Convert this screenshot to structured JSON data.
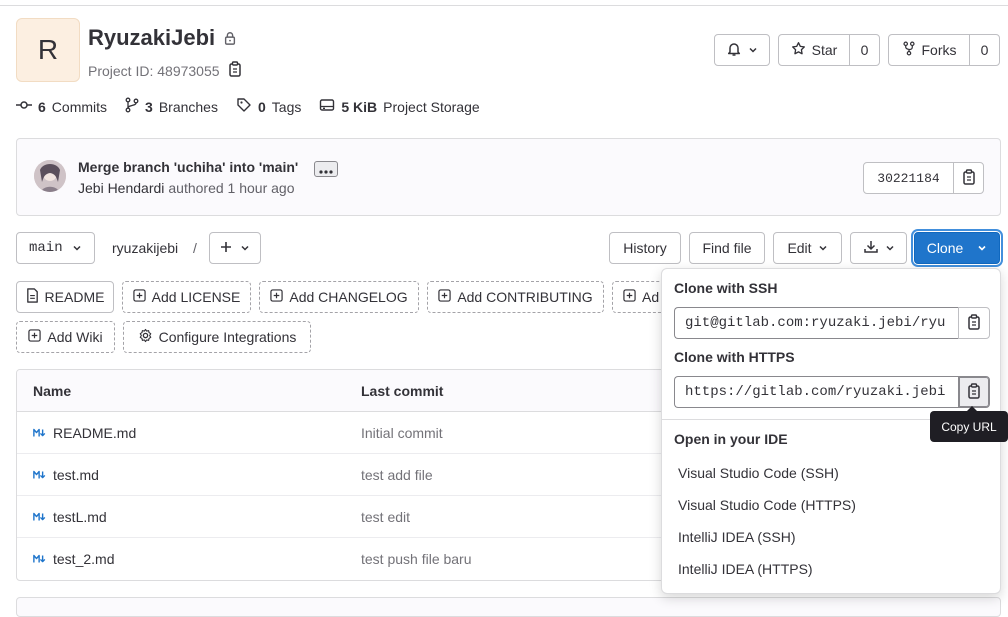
{
  "project": {
    "avatar_letter": "R",
    "name": "RyuzakiJebi",
    "id_text": "Project ID: 48973055"
  },
  "header_actions": {
    "star_label": "Star",
    "star_count": "0",
    "forks_label": "Forks",
    "forks_count": "0"
  },
  "stats": {
    "commits_count": "6",
    "commits_label": "Commits",
    "branches_count": "3",
    "branches_label": "Branches",
    "tags_count": "0",
    "tags_label": "Tags",
    "storage_size": "5 KiB",
    "storage_label": "Project Storage"
  },
  "last_commit": {
    "message": "Merge branch 'uchiha' into 'main'",
    "author": "Jebi Hendardi",
    "authored_text": "authored 1 hour ago",
    "sha": "30221184"
  },
  "toolbar": {
    "branch": "main",
    "path": "ryuzakijebi",
    "path_sep": "/",
    "history": "History",
    "find_file": "Find file",
    "edit": "Edit",
    "clone": "Clone"
  },
  "quick_actions": [
    "README",
    "Add LICENSE",
    "Add CHANGELOG",
    "Add CONTRIBUTING",
    "Ad",
    "Add Wiki",
    "Configure Integrations"
  ],
  "table": {
    "col_name": "Name",
    "col_commit": "Last commit",
    "rows": [
      {
        "name": "README.md",
        "commit": "Initial commit"
      },
      {
        "name": "test.md",
        "commit": "test add file"
      },
      {
        "name": "testL.md",
        "commit": "test edit"
      },
      {
        "name": "test_2.md",
        "commit": "test push file baru"
      }
    ]
  },
  "clone_dropdown": {
    "ssh_heading": "Clone with SSH",
    "ssh_url": "git@gitlab.com:ryuzaki.jebi/ryu",
    "https_heading": "Clone with HTTPS",
    "https_url": "https://gitlab.com/ryuzaki.jebi",
    "ide_heading": "Open in your IDE",
    "ide_items": [
      "Visual Studio Code (SSH)",
      "Visual Studio Code (HTTPS)",
      "IntelliJ IDEA (SSH)",
      "IntelliJ IDEA (HTTPS)"
    ]
  },
  "tooltip": "Copy URL",
  "colors": {
    "primary": "#1f75cb",
    "avatar_bg": "#fcefe1",
    "markdown_icon": "#1f75cb"
  }
}
